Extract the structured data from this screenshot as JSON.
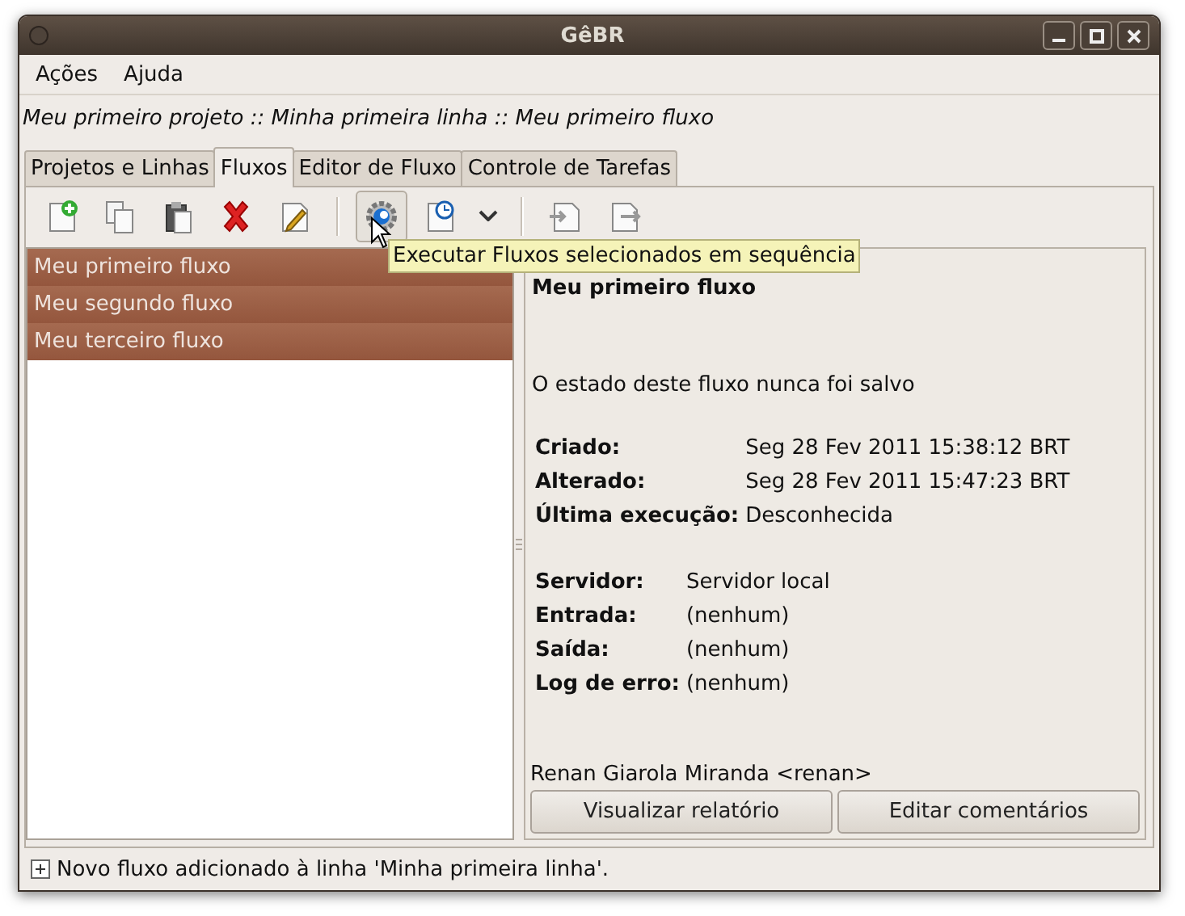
{
  "window": {
    "title": "GêBR"
  },
  "menu": [
    {
      "label": "Ações"
    },
    {
      "label": "Ajuda"
    }
  ],
  "breadcrumb": "Meu primeiro projeto :: Minha primeira linha :: Meu primeiro fluxo",
  "tabs": [
    {
      "label": "Projetos e Linhas",
      "selected": false
    },
    {
      "label": "Fluxos",
      "selected": true
    },
    {
      "label": "Editor de Fluxo",
      "selected": false
    },
    {
      "label": "Controle de Tarefas",
      "selected": false
    }
  ],
  "toolbar": [
    {
      "kind": "new",
      "hovered": false
    },
    {
      "kind": "copy",
      "hovered": false
    },
    {
      "kind": "paste",
      "hovered": false
    },
    {
      "kind": "delete",
      "hovered": false
    },
    {
      "kind": "edit",
      "hovered": false
    },
    {
      "kind": "separator"
    },
    {
      "kind": "run",
      "hovered": true
    },
    {
      "kind": "schedule",
      "hovered": false
    },
    {
      "kind": "dropdown",
      "hovered": false
    },
    {
      "kind": "separator"
    },
    {
      "kind": "import",
      "hovered": false
    },
    {
      "kind": "export",
      "hovered": false
    }
  ],
  "tooltip": "Executar Fluxos selecionados em sequência",
  "flows": [
    {
      "name": "Meu primeiro fluxo",
      "selected": true
    },
    {
      "name": "Meu segundo fluxo",
      "selected": true
    },
    {
      "name": "Meu terceiro fluxo",
      "selected": true
    }
  ],
  "details": {
    "title": "Meu primeiro fluxo",
    "state": "O estado deste fluxo nunca foi salvo",
    "groups": [
      [
        {
          "label": "Criado:",
          "value": "Seg 28 Fev 2011 15:38:12 BRT"
        },
        {
          "label": "Alterado:",
          "value": "Seg 28 Fev 2011 15:47:23 BRT"
        },
        {
          "label": "Última execução:",
          "value": "Desconhecida"
        }
      ],
      [
        {
          "label": "Servidor:",
          "value": "Servidor local"
        },
        {
          "label": "Entrada:",
          "value": "(nenhum)"
        },
        {
          "label": "Saída:",
          "value": "(nenhum)"
        },
        {
          "label": "Log de erro:",
          "value": "(nenhum)"
        }
      ]
    ],
    "author": "Renan Giarola Miranda <renan>",
    "buttons": [
      "Visualizar relatório",
      "Editar comentários"
    ]
  },
  "status_bar": {
    "text": "Novo fluxo adicionado à linha 'Minha primeira linha'."
  }
}
